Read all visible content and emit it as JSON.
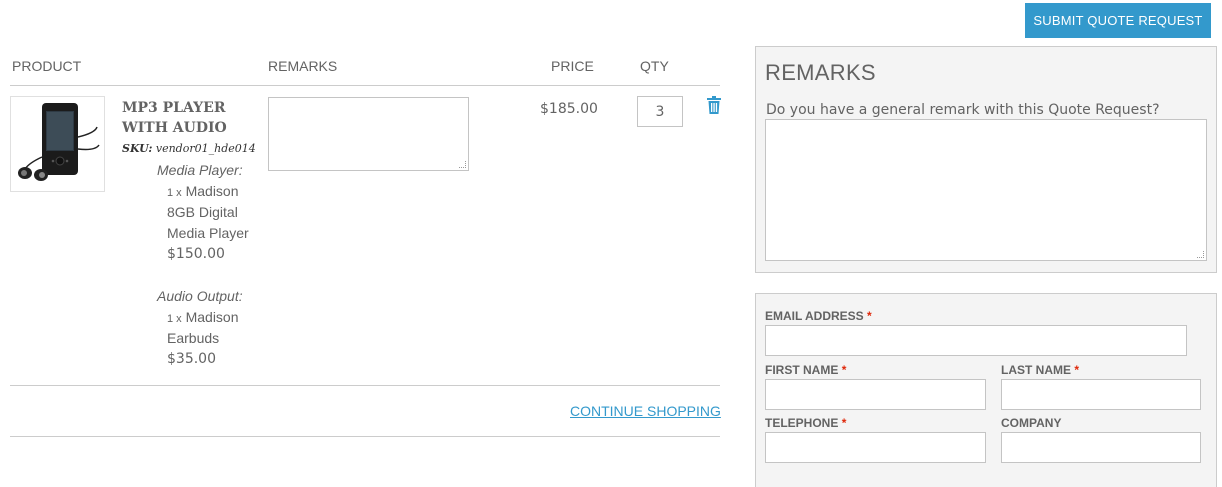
{
  "toolbar": {
    "submit_label": "SUBMIT QUOTE REQUEST"
  },
  "table": {
    "headers": {
      "product": "PRODUCT",
      "remarks": "REMARKS",
      "price": "PRICE",
      "qty": "QTY"
    }
  },
  "item": {
    "name_line1": "MP3 PLAYER",
    "name_line2": "WITH AUDIO",
    "sku_label": "SKU:",
    "sku": "vendor01_hde014",
    "options": [
      {
        "label": "Media Player:",
        "qty": "1 x",
        "lines": [
          "Madison",
          "8GB Digital",
          "Media Player"
        ],
        "price": "$150.00"
      },
      {
        "label": "Audio Output:",
        "qty": "1 x",
        "lines": [
          "Madison",
          "Earbuds"
        ],
        "price": "$35.00"
      }
    ],
    "price": "$185.00",
    "qty": "3",
    "remark": ""
  },
  "links": {
    "continue": "CONTINUE SHOPPING"
  },
  "remarks_panel": {
    "title": "REMARKS",
    "question": "Do you have a general remark with this Quote Request?",
    "value": ""
  },
  "form": {
    "required_mark": "*",
    "email_label": "EMAIL ADDRESS",
    "first_name_label": "FIRST NAME",
    "last_name_label": "LAST NAME",
    "telephone_label": "TELEPHONE",
    "company_label": "COMPANY",
    "email": "",
    "first_name": "",
    "last_name": "",
    "telephone": "",
    "company": ""
  },
  "icons": {
    "delete": "trash-icon",
    "product": "mp3-player-image"
  },
  "colors": {
    "accent": "#3399cc",
    "required": "#df280a",
    "text": "#636363",
    "panel_bg": "#f4f4f4"
  }
}
